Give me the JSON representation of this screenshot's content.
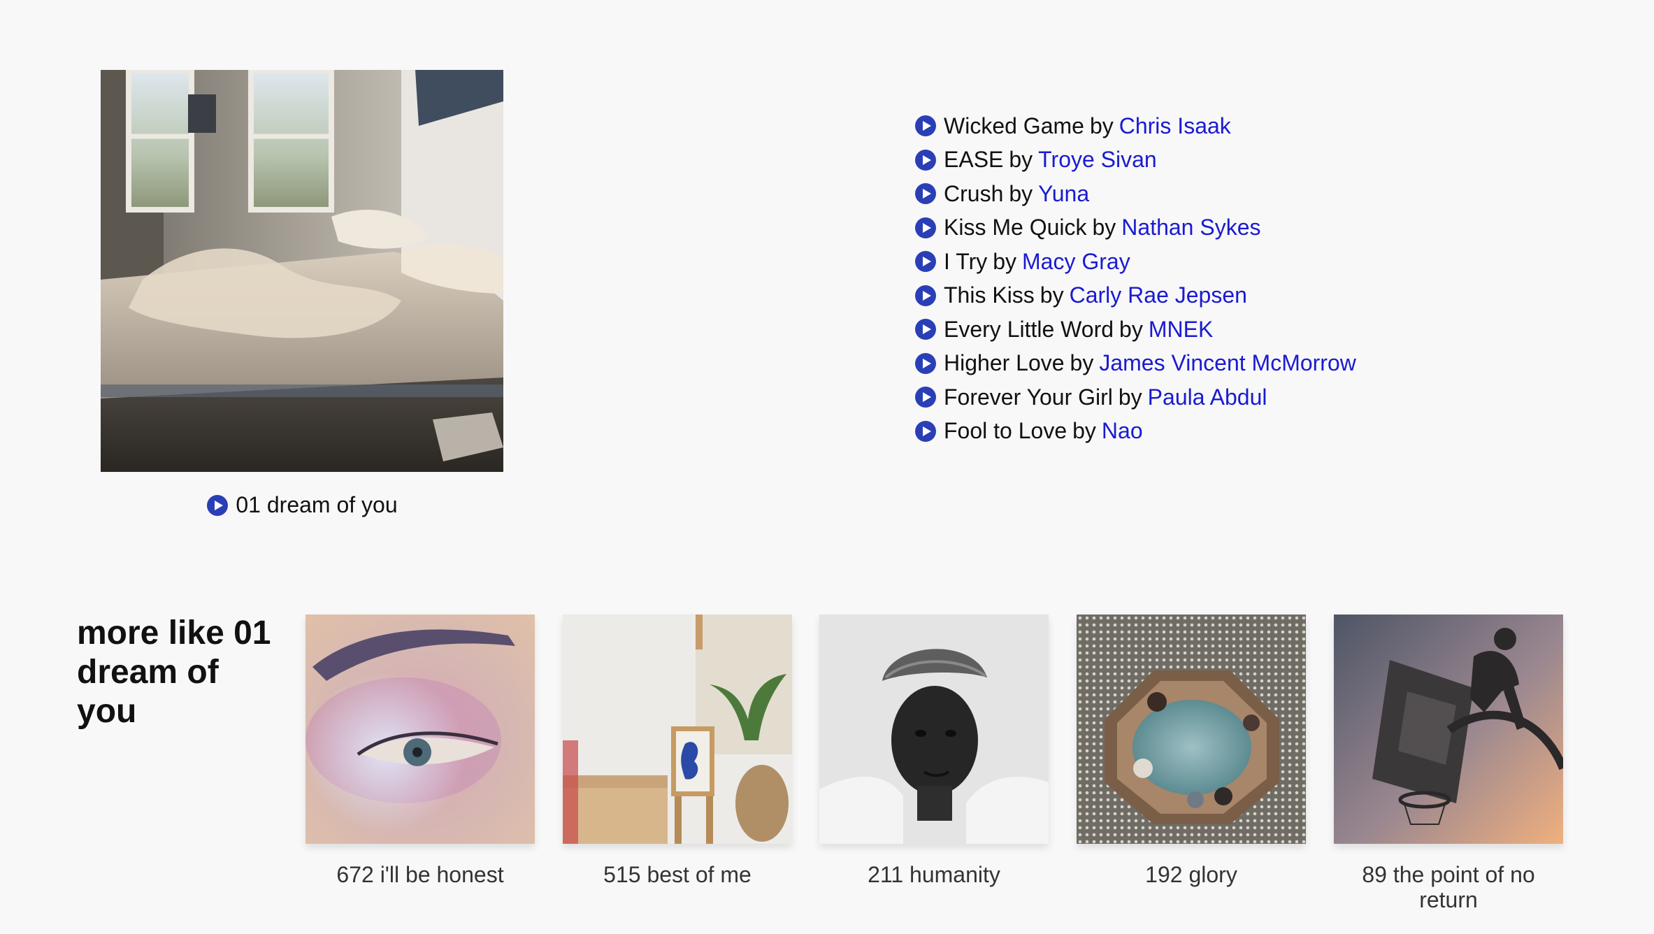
{
  "featured": {
    "title": "01 dream of you",
    "cover_icon": "unmade-bed-photo"
  },
  "tracks": [
    {
      "song": "Wicked Game",
      "by": "by",
      "artist": "Chris Isaak"
    },
    {
      "song": "EASE",
      "by": "by",
      "artist": "Troye Sivan"
    },
    {
      "song": "Crush",
      "by": "by",
      "artist": "Yuna"
    },
    {
      "song": "Kiss Me Quick",
      "by": "by",
      "artist": "Nathan Sykes"
    },
    {
      "song": "I Try",
      "by": "by",
      "artist": "Macy Gray"
    },
    {
      "song": "This Kiss",
      "by": "by",
      "artist": "Carly Rae Jepsen"
    },
    {
      "song": "Every Little Word",
      "by": "by",
      "artist": "MNEK"
    },
    {
      "song": "Higher Love",
      "by": "by",
      "artist": "James Vincent McMorrow"
    },
    {
      "song": "Forever Your Girl",
      "by": "by",
      "artist": "Paula Abdul"
    },
    {
      "song": "Fool to Love",
      "by": "by",
      "artist": "Nao"
    }
  ],
  "more_like": {
    "heading": "more like 01 dream of you",
    "items": [
      {
        "title": "672 i'll be honest",
        "image": "eye-makeup-photo"
      },
      {
        "title": "515 best of me",
        "image": "interior-plant-photo"
      },
      {
        "title": "211 humanity",
        "image": "portrait-cap-photo"
      },
      {
        "title": "192 glory",
        "image": "fountain-aerial-photo"
      },
      {
        "title": "89 the point of no return",
        "image": "basketball-hoop-photo"
      }
    ]
  },
  "colors": {
    "background": "#f8f8f8",
    "link": "#1a1ad2",
    "play_icon": "#2a3fb5"
  }
}
